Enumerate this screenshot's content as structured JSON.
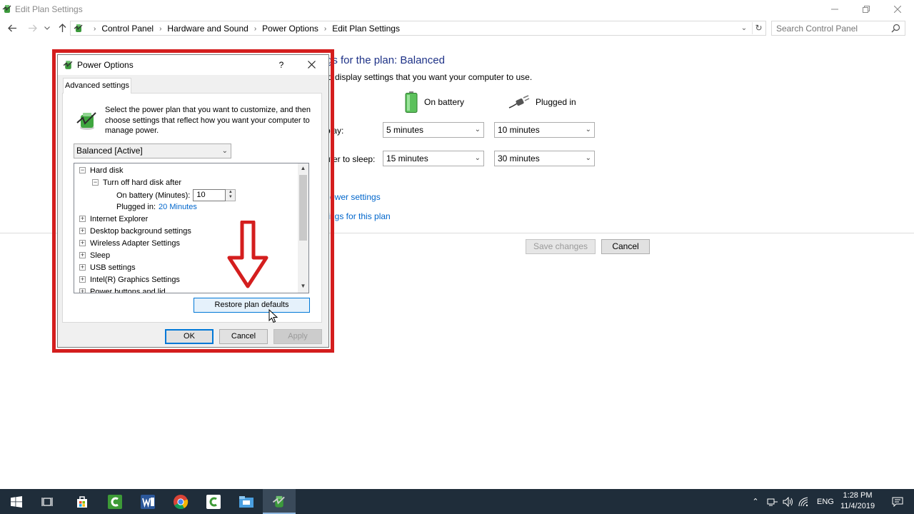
{
  "window": {
    "title": "Edit Plan Settings",
    "minimize_icon": "minimize-icon",
    "restore_icon": "restore-icon",
    "close_icon": "close-icon"
  },
  "address_bar": {
    "crumbs": [
      "Control Panel",
      "Hardware and Sound",
      "Power Options",
      "Edit Plan Settings"
    ],
    "search_placeholder": "Search Control Panel"
  },
  "background": {
    "heading": "gs for the plan: Balanced",
    "description": "d display settings that you want your computer to use.",
    "on_battery_label": "On battery",
    "plugged_in_label": "Plugged in",
    "rows": [
      {
        "label": "play:",
        "battery_value": "5 minutes",
        "plugged_value": "10 minutes"
      },
      {
        "label": "uter to sleep:",
        "battery_value": "15 minutes",
        "plugged_value": "30 minutes"
      }
    ],
    "links": [
      "ower settings",
      "tings for this plan"
    ],
    "save_label": "Save changes",
    "cancel_label": "Cancel"
  },
  "dialog": {
    "title": "Power Options",
    "help_label": "?",
    "tab_label": "Advanced settings",
    "intro": "Select the power plan that you want to customize, and then choose settings that reflect how you want your computer to manage power.",
    "plan_selected": "Balanced [Active]",
    "tree": {
      "hard_disk": "Hard disk",
      "turn_off": "Turn off hard disk after",
      "on_battery_label": "On battery (Minutes):",
      "on_battery_value": "10",
      "plugged_label": "Plugged in:",
      "plugged_value": "20 Minutes",
      "items": [
        "Internet Explorer",
        "Desktop background settings",
        "Wireless Adapter Settings",
        "Sleep",
        "USB settings",
        "Intel(R) Graphics Settings",
        "Power buttons and lid"
      ]
    },
    "restore_label": "Restore plan defaults",
    "ok_label": "OK",
    "cancel_label": "Cancel",
    "apply_label": "Apply"
  },
  "taskbar": {
    "items": [
      "start-icon",
      "task-view-icon",
      "store-icon",
      "camtasia-icon",
      "word-icon",
      "chrome-icon",
      "camtasia-recorder-icon",
      "file-explorer-icon",
      "power-options-icon"
    ],
    "language": "ENG",
    "time": "1:28 PM",
    "date": "11/4/2019"
  },
  "colors": {
    "accent": "#0078d7",
    "link": "#0066cc",
    "heading": "#1e3287",
    "highlight_frame": "#d41e1e",
    "taskbar": "#1f2d3a"
  }
}
